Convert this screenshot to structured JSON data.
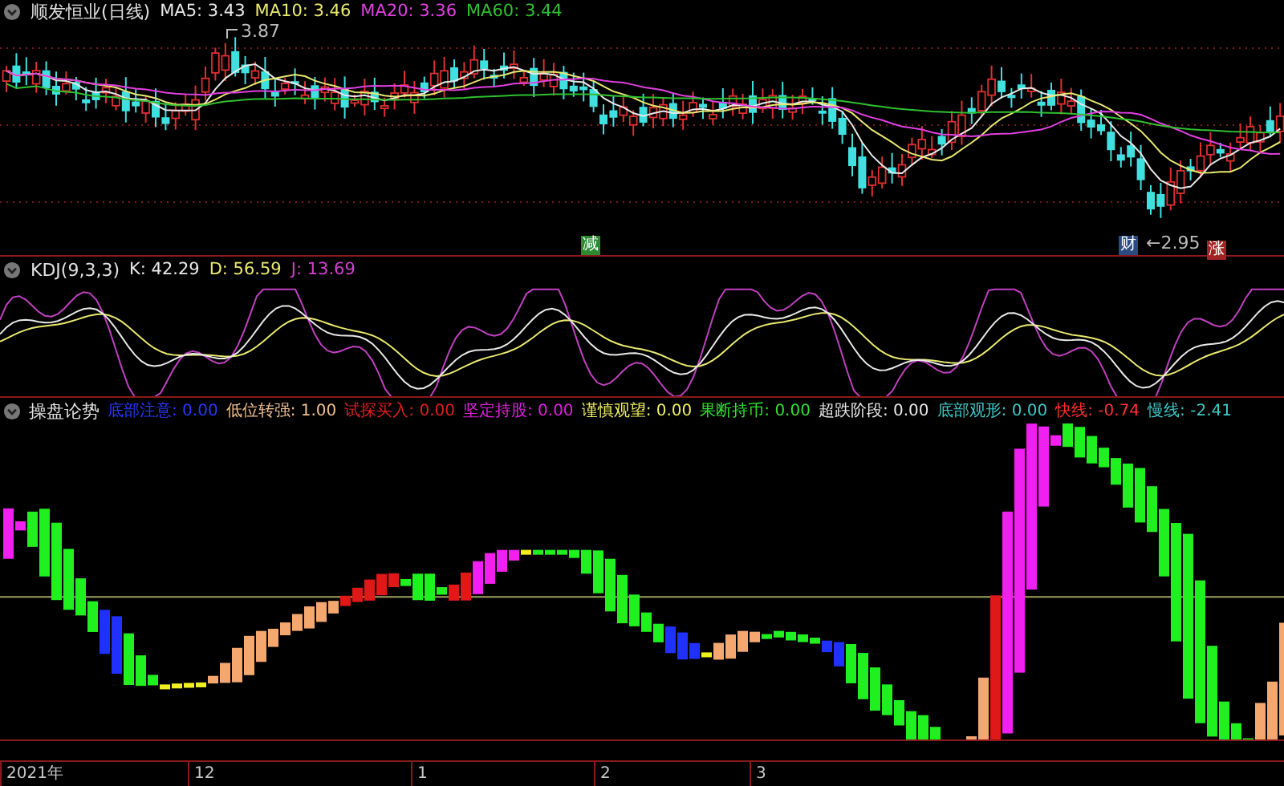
{
  "price_panel": {
    "title": "顺发恒业(日线)",
    "indicators": [
      {
        "text": "MA5: 3.43",
        "color": "#e8e8e8"
      },
      {
        "text": "MA10: 3.46",
        "color": "#e8e870"
      },
      {
        "text": "MA20: 3.36",
        "color": "#e040e0"
      },
      {
        "text": "MA60: 3.44",
        "color": "#30c030"
      }
    ],
    "high_label": "3.87",
    "low_label": "←2.95",
    "markers": [
      {
        "text": "减",
        "color": "#2c8a30"
      },
      {
        "text": "财",
        "color": "#2a4a80"
      },
      {
        "text": "涨",
        "color": "#a02424"
      }
    ]
  },
  "kdj_panel": {
    "title": "KDJ(9,3,3)",
    "readings": [
      {
        "text": "K: 42.29",
        "color": "#e8e8e8"
      },
      {
        "text": "D: 56.59",
        "color": "#e8e870"
      },
      {
        "text": "J: 13.69",
        "color": "#d040d0"
      }
    ]
  },
  "indicator_panel": {
    "title": "操盘论势",
    "readings": [
      {
        "text": "底部注意: 0.00",
        "color": "#2838ff"
      },
      {
        "text": "低位转强: 1.00",
        "color": "#f0c090"
      },
      {
        "text": "试探买入: 0.00",
        "color": "#e02020"
      },
      {
        "text": "坚定持股: 0.00",
        "color": "#e020e0"
      },
      {
        "text": "谨慎观望: 0.00",
        "color": "#f0f060"
      },
      {
        "text": "果断持币: 0.00",
        "color": "#30e030"
      },
      {
        "text": "超跌阶段: 0.00",
        "color": "#e8e8e8"
      },
      {
        "text": "底部观形: 0.00",
        "color": "#40c8c8"
      },
      {
        "text": "快线: -0.74",
        "color": "#ff3030"
      },
      {
        "text": "慢线: -2.41",
        "color": "#40c8c8"
      }
    ]
  },
  "time_axis": {
    "labels": [
      "2021年",
      "12",
      "1",
      "2",
      "3"
    ]
  }
}
